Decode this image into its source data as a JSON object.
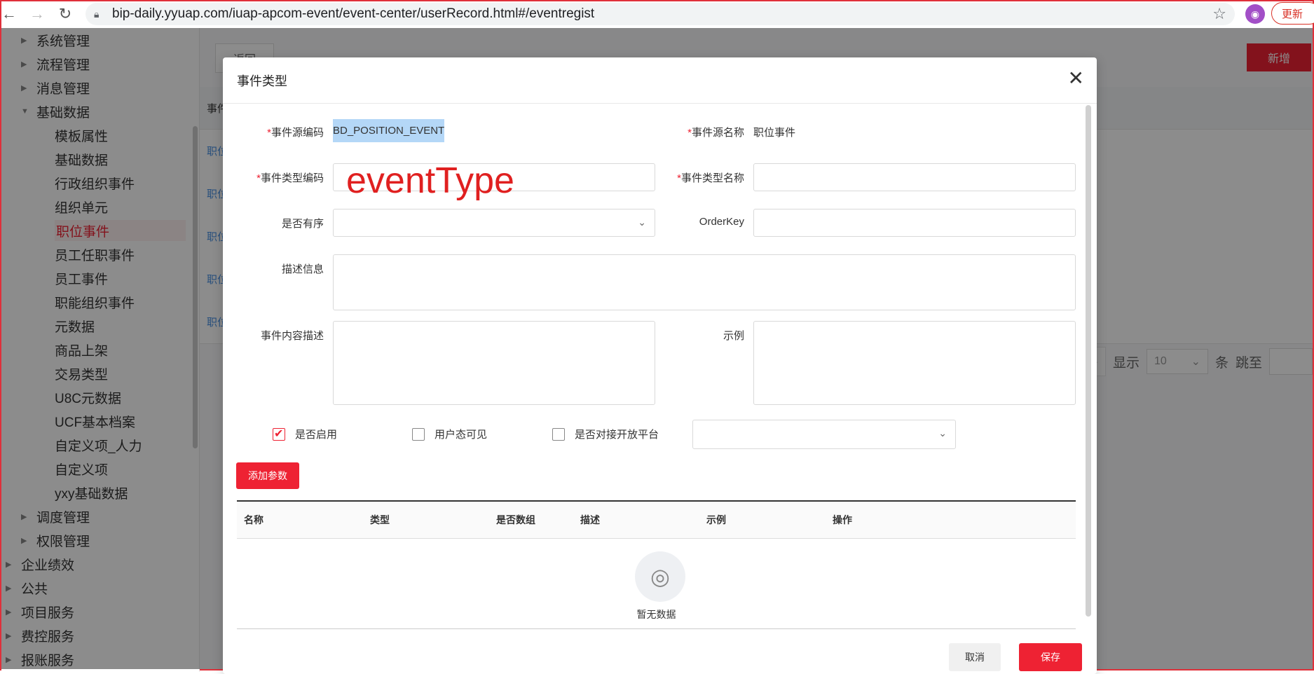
{
  "browser": {
    "url": "bip-daily.yyuap.com/iuap-apcom-event/event-center/userRecord.html#/eventregist",
    "update_label": "更新"
  },
  "sidebar": {
    "items": [
      {
        "label": "系统管理",
        "level": 1
      },
      {
        "label": "流程管理",
        "level": 1
      },
      {
        "label": "消息管理",
        "level": 1
      },
      {
        "label": "基础数据",
        "level": 1,
        "expanded": true
      },
      {
        "label": "模板属性",
        "level": 2
      },
      {
        "label": "基础数据",
        "level": 2
      },
      {
        "label": "行政组织事件",
        "level": 2
      },
      {
        "label": "组织单元",
        "level": 2
      },
      {
        "label": "职位事件",
        "level": 2,
        "active": true
      },
      {
        "label": "员工任职事件",
        "level": 2
      },
      {
        "label": "员工事件",
        "level": 2
      },
      {
        "label": "职能组织事件",
        "level": 2
      },
      {
        "label": "元数据",
        "level": 2
      },
      {
        "label": "商品上架",
        "level": 2
      },
      {
        "label": "交易类型",
        "level": 2
      },
      {
        "label": "U8C元数据",
        "level": 2
      },
      {
        "label": "UCF基本档案",
        "level": 2
      },
      {
        "label": "自定义项_人力",
        "level": 2
      },
      {
        "label": "自定义项",
        "level": 2
      },
      {
        "label": "yxy基础数据",
        "level": 2
      },
      {
        "label": "调度管理",
        "level": 1
      },
      {
        "label": "权限管理",
        "level": 1
      },
      {
        "label": "企业绩效",
        "level": 0
      },
      {
        "label": "公共",
        "level": 0
      },
      {
        "label": "项目服务",
        "level": 0
      },
      {
        "label": "费控服务",
        "level": 0
      },
      {
        "label": "报账服务",
        "level": 0
      }
    ]
  },
  "background": {
    "back_label": "返回",
    "new_label": "新增",
    "table_head_label": "事件",
    "row_label": "职位",
    "pager_show": "显示",
    "pager_size": "10",
    "pager_unit": "条",
    "pager_jump": "跳至"
  },
  "modal": {
    "title": "事件类型",
    "fields": {
      "source_code_label": "事件源编码",
      "source_code_value": "BD_POSITION_EVENT",
      "source_name_label": "事件源名称",
      "source_name_value": "职位事件",
      "type_code_label": "事件类型编码",
      "type_code_value": "",
      "type_name_label": "事件类型名称",
      "type_name_value": "",
      "ordered_label": "是否有序",
      "ordered_value": "",
      "orderkey_label": "OrderKey",
      "orderkey_value": "",
      "desc_label": "描述信息",
      "content_desc_label": "事件内容描述",
      "example_label": "示例"
    },
    "annotation": "eventType",
    "checkboxes": [
      {
        "label": "是否启用",
        "checked": true
      },
      {
        "label": "用户态可见",
        "checked": false
      },
      {
        "label": "是否对接开放平台",
        "checked": false
      }
    ],
    "add_param_label": "添加参数",
    "param_table": {
      "columns": [
        "名称",
        "类型",
        "是否数组",
        "描述",
        "示例",
        "操作"
      ],
      "empty_text": "暂无数据"
    },
    "cancel_label": "取消",
    "save_label": "保存"
  },
  "colors": {
    "accent": "#ee2233",
    "link": "#4a90e2",
    "selection": "#b4d7f7"
  }
}
